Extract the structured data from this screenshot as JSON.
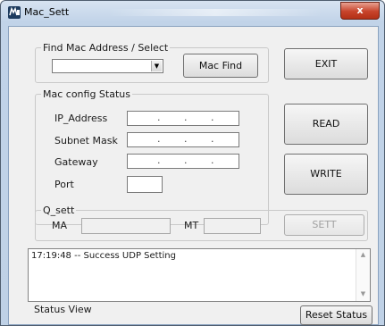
{
  "window": {
    "title": "Mac_Sett",
    "close_glyph": "x",
    "icon": "app-icon"
  },
  "find_group": {
    "legend": "Find Mac Address / Select",
    "combo_value": "",
    "combo_arrow": "▼",
    "find_button": "Mac Find"
  },
  "exit_button": "EXIT",
  "config_group": {
    "legend": "Mac config Status",
    "ip_label": "IP_Address",
    "subnet_label": "Subnet Mask",
    "gateway_label": "Gateway",
    "port_label": "Port",
    "ip_value": [
      ".",
      ".",
      "."
    ],
    "subnet_value": [
      ".",
      ".",
      "."
    ],
    "gateway_value": [
      ".",
      ".",
      "."
    ],
    "port_value": ""
  },
  "read_button": "READ",
  "write_button": "WRITE",
  "qsett_group": {
    "legend": "Q_sett",
    "ma_label": "MA",
    "mt_label": "MT",
    "ma_value": "",
    "mt_value": "",
    "sett_button": "SETT"
  },
  "log": {
    "line": "17:19:48 -- Success UDP Setting",
    "scroll_up": "▲",
    "scroll_down": "▼"
  },
  "status_label": "Status View",
  "reset_button": "Reset Status"
}
